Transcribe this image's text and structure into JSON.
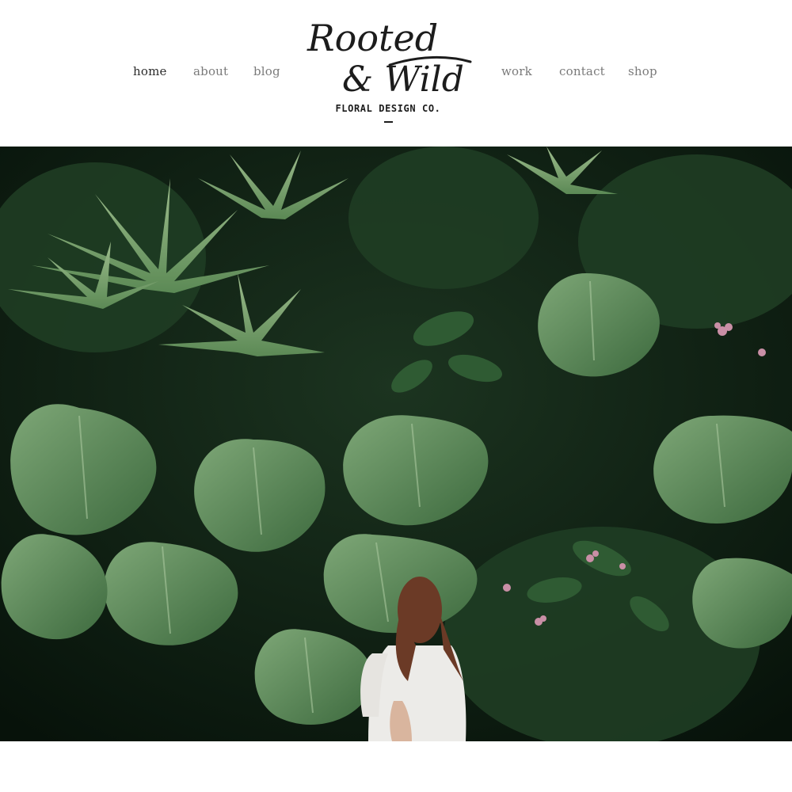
{
  "nav": {
    "left": [
      {
        "label": "home",
        "active": true
      },
      {
        "label": "about",
        "active": false
      },
      {
        "label": "blog",
        "active": false
      }
    ],
    "right": [
      {
        "label": "work",
        "active": false
      },
      {
        "label": "contact",
        "active": false
      },
      {
        "label": "shop",
        "active": false
      }
    ]
  },
  "logo": {
    "line1": "Rooted",
    "line2": "& Wild",
    "tagline": "FLORAL DESIGN CO."
  },
  "hero": {
    "icon": "tropical-foliage-photo",
    "colors": {
      "deep": "#0e1f12",
      "leaf": "#4f7f4a",
      "leaf_light": "#8bb07f",
      "flower": "#c98fa6"
    }
  }
}
